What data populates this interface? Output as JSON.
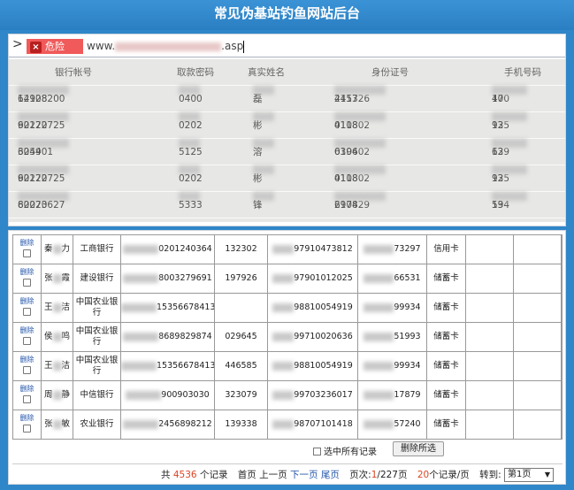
{
  "window": {
    "title": "常见伪基站钓鱼网站后台"
  },
  "address_bar": {
    "chevron": ">",
    "danger_label": "危险",
    "url_prefix": "www.",
    "url_suffix": ".asp"
  },
  "top_table": {
    "headers": [
      "银行帐号",
      "取款密码",
      "真实姓名",
      "身份证号",
      "手机号码"
    ],
    "rows": [
      [
        "62108",
        "14928200",
        "0400",
        "磊",
        "411326",
        "2457",
        "170",
        "40"
      ],
      [
        "62270",
        "90122725",
        "0202",
        "彬",
        "410802",
        "0118",
        "135",
        "92"
      ],
      [
        "6259",
        "304401",
        "5125",
        "溶",
        "610402",
        "0396",
        "139",
        "62"
      ],
      [
        "62270",
        "90122725",
        "0202",
        "彬",
        "410802",
        "0118",
        "135",
        "92"
      ],
      [
        "62270",
        "80023627",
        "5333",
        "锋",
        "610429",
        "2978",
        "134",
        "59"
      ]
    ]
  },
  "bottom_table": {
    "delete_label": "删除",
    "rows": [
      {
        "name_a": "秦",
        "name_b": "力",
        "bank": "工商银行",
        "card": "0201240364",
        "pwd": "132302",
        "phone": "97910473812",
        "id_tail": "73297",
        "type": "信用卡"
      },
      {
        "name_a": "张",
        "name_b": "霞",
        "bank": "建设银行",
        "card": "8003279691",
        "pwd": "197926",
        "phone": "97901012025",
        "id_tail": "66531",
        "type": "储蓄卡"
      },
      {
        "name_a": "王",
        "name_b": "洁",
        "bank": "中国农业银行",
        "card": "15356678413",
        "pwd": "",
        "phone": "98810054919",
        "id_tail": "99934",
        "type": "储蓄卡"
      },
      {
        "name_a": "侯",
        "name_b": "鸣",
        "bank": "中国农业银行",
        "card": "8689829874",
        "pwd": "029645",
        "phone": "99710020636",
        "id_tail": "51993",
        "type": "储蓄卡"
      },
      {
        "name_a": "王",
        "name_b": "洁",
        "bank": "中国农业银行",
        "card": "15356678413",
        "pwd": "446585",
        "phone": "98810054919",
        "id_tail": "99934",
        "type": "储蓄卡"
      },
      {
        "name_a": "周",
        "name_b": "静",
        "bank": "中信银行",
        "card": "900903030",
        "pwd": "323079",
        "phone": "99703236017",
        "id_tail": "17879",
        "type": "储蓄卡"
      },
      {
        "name_a": "张",
        "name_b": "敏",
        "bank": "农业银行",
        "card": "2456898212",
        "pwd": "139338",
        "phone": "98707101418",
        "id_tail": "57240",
        "type": "储蓄卡"
      }
    ]
  },
  "footer": {
    "select_all": "选中所有记录",
    "delete_selected": "删除所选",
    "total_prefix": "共",
    "total_count": "4536",
    "total_suffix": "个记录",
    "first": "首页",
    "prev": "上一页",
    "next": "下一页",
    "last": "尾页",
    "page_label": "页次:",
    "page_current": "1",
    "page_total": "/227页",
    "per_page": "20",
    "per_page_suffix": "个记录/页",
    "goto": "转到:",
    "page_select": "第1页"
  }
}
